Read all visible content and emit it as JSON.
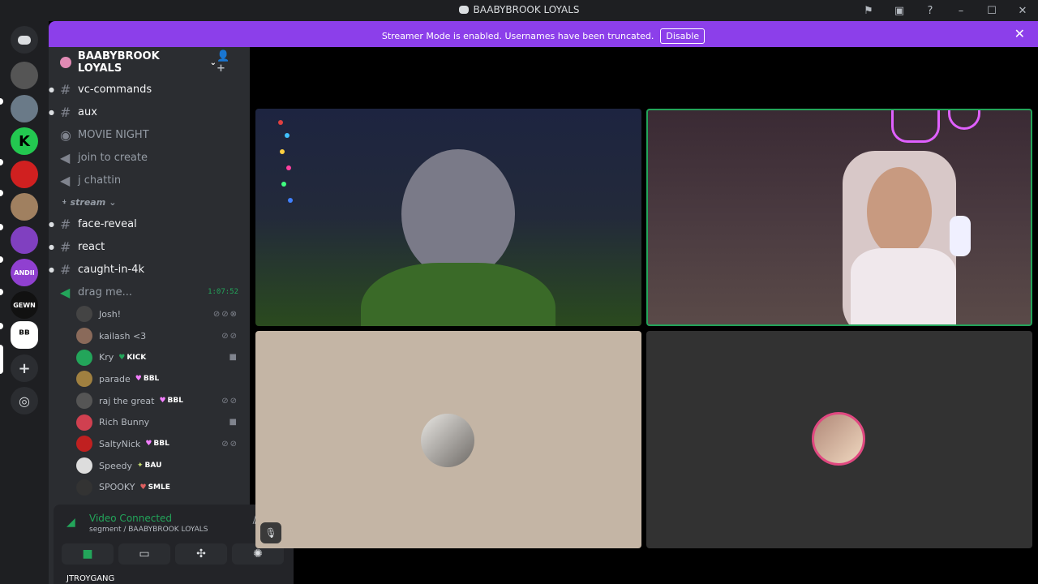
{
  "window": {
    "title": "BAABYBROOK LOYALS"
  },
  "banner": {
    "message": "Streamer Mode is enabled. Usernames have been truncated.",
    "disable_label": "Disable"
  },
  "server": {
    "name": "BAABYBROOK LOYALS"
  },
  "channels_top": [
    {
      "name": "vc-commands",
      "type": "text",
      "unread": true
    },
    {
      "name": "aux",
      "type": "text",
      "unread": true
    },
    {
      "name": "MOVIE NIGHT",
      "type": "stage",
      "unread": false
    },
    {
      "name": "join to create",
      "type": "voice",
      "unread": false
    },
    {
      "name": "j chattin",
      "type": "voice",
      "unread": false
    }
  ],
  "category": {
    "name": "stream"
  },
  "channels_stream": [
    {
      "name": "face-reveal",
      "type": "text",
      "unread": true
    },
    {
      "name": "react",
      "type": "text",
      "unread": true
    },
    {
      "name": "caught-in-4k",
      "type": "text",
      "unread": true
    }
  ],
  "active_voice": {
    "name": "drag me...",
    "timer": "1:07:52"
  },
  "voice_users": [
    {
      "name": "Josh!",
      "tag": "",
      "icons": "deafened muted xbox"
    },
    {
      "name": "kailash <3",
      "tag": "",
      "icons": "muted deafened"
    },
    {
      "name": "Kry",
      "tag": "KICK",
      "icons": "video"
    },
    {
      "name": "parade",
      "tag": "BBL",
      "icons": ""
    },
    {
      "name": "raj the great",
      "tag": "BBL",
      "icons": "muted deafened"
    },
    {
      "name": "Rich Bunny",
      "tag": "",
      "icons": "video"
    },
    {
      "name": "SaltyNick",
      "tag": "BBL",
      "icons": "muted deafened"
    },
    {
      "name": "Speedy",
      "tag": "BAU",
      "icons": ""
    },
    {
      "name": "SPOOKY",
      "tag": "SMLE",
      "icons": ""
    }
  ],
  "voice_panel": {
    "status": "Video Connected",
    "sub": "segment / BAABYBROOK LOYALS"
  },
  "user_panel": {
    "name": "JTROYGANG"
  },
  "colors": {
    "accent": "#8c3fea",
    "online": "#23a55a",
    "sidebar": "#2b2d31"
  }
}
